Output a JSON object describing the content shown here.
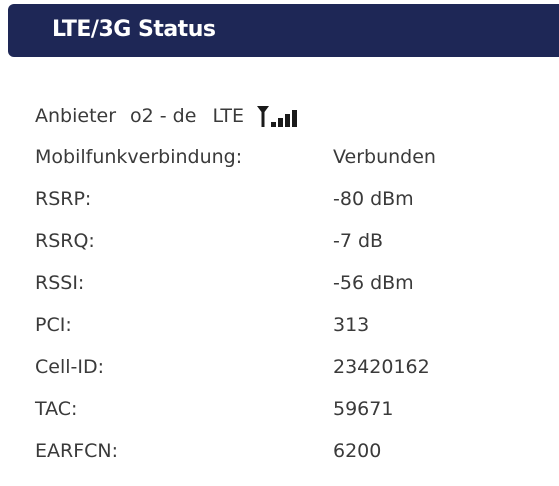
{
  "panel": {
    "title": "LTE/3G Status"
  },
  "provider": {
    "label": "Anbieter",
    "name": "o2 - de",
    "technology": "LTE",
    "signal_icon": "signal-strength-icon",
    "signal_bars_filled": 4,
    "signal_bars_total": 4
  },
  "rows": [
    {
      "label": "Mobilfunkverbindung:",
      "value": "Verbunden"
    },
    {
      "label": "RSRP:",
      "value": "-80 dBm"
    },
    {
      "label": "RSRQ:",
      "value": "-7 dB"
    },
    {
      "label": "RSSI:",
      "value": "-56 dBm"
    },
    {
      "label": "PCI:",
      "value": "313"
    },
    {
      "label": "Cell-ID:",
      "value": "23420162"
    },
    {
      "label": "TAC:",
      "value": "59671"
    },
    {
      "label": "EARFCN:",
      "value": "6200"
    }
  ],
  "colors": {
    "header_bg": "#1e2756",
    "header_text": "#ffffff",
    "body_text": "#3a3a3a",
    "icon": "#1a1a1a"
  }
}
